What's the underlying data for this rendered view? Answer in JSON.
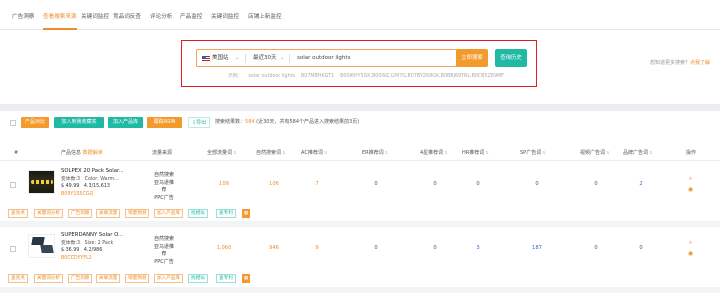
{
  "tabs": [
    "广告洞察",
    "查看搜索来源",
    "关键词监控",
    "竞品词反查",
    "评论分析",
    "产品监控",
    "关键词监控",
    "店铺上新监控"
  ],
  "search": {
    "marketplace": "美国站",
    "time_range": "最近30天",
    "query": "solar outdoor lights",
    "query_button": "立即搜索",
    "history_button": "查询历史",
    "examples_label": "示例：",
    "examples": [
      "solar outdoor lights",
      "B07MBHKGT1",
      "B00I6HY5GK,B00I9Z,I2M7G,B07BYZ68GK,B0BBJ69TRL,B0CB5Z69MF"
    ],
    "more_text": "想知道更多搜索？",
    "more_link": "点我了解"
  },
  "actions": {
    "filter_button": "产品对比",
    "add_favorite": "加入到我收藏夹",
    "add_lib": "加入产品库",
    "tracking": "跟踪ASIN",
    "export": "导出",
    "result_prefix": "搜索结果数：",
    "result_count": "584",
    "result_suffix": "(近30天，共有584个产品进入搜索结果前3页)"
  },
  "columns": {
    "index": "#",
    "product": "产品信息",
    "product_sub": "数据解读",
    "source": "流量来源",
    "all_kw": "全部流量词",
    "natural_kw": "自然搜索词",
    "ac_kw": "AC推荐词",
    "er_kw": "ER推荐词",
    "fourstar_kw": "4星推荐词",
    "hr_kw": "HR推荐词",
    "sp_kw": "SP广告词",
    "video_kw": "视频广告词",
    "brand_kw": "品牌广告词",
    "ops": "操作"
  },
  "products": [
    {
      "title": "SOLPEX 20 Pack Solar...",
      "variants": "变体数:3",
      "color": "Color: Warm...",
      "price": "$ 49.99",
      "rating": "4.3/15,613",
      "asin": "B09Y1S5CGQ",
      "source_lines": [
        "自然搜索",
        "亚马逊推荐",
        "PPC广告"
      ],
      "all_kw": "109",
      "natural_kw": "106",
      "ac_kw": "7",
      "er_kw": "0",
      "fourstar_kw": "0",
      "hr_kw": "0",
      "sp_kw": "0",
      "video_kw": "0",
      "brand_kw": "2"
    },
    {
      "title": "SUPERDANNY Solar O...",
      "variants": "变体数:3",
      "color": "Size: 2 Pack",
      "price": "$ 36.99",
      "rating": "4.2/986",
      "asin": "B0CCDYYFL2",
      "source_lines": [
        "自然搜索",
        "亚马逊推荐",
        "PPC广告"
      ],
      "all_kw": "1,060",
      "natural_kw": "946",
      "ac_kw": "9",
      "er_kw": "0",
      "fourstar_kw": "0",
      "hr_kw": "3",
      "sp_kw": "187",
      "video_kw": "0",
      "brand_kw": "0"
    }
  ],
  "row_tags": [
    "查亮点",
    "关键词分析",
    "广告洞察",
    "关联流量",
    "销量预测",
    "加入产品库",
    "找相似",
    "查专利"
  ],
  "colors": {
    "accent": "#f08c28",
    "teal": "#1fb9a4",
    "highlight": "#e02020"
  }
}
